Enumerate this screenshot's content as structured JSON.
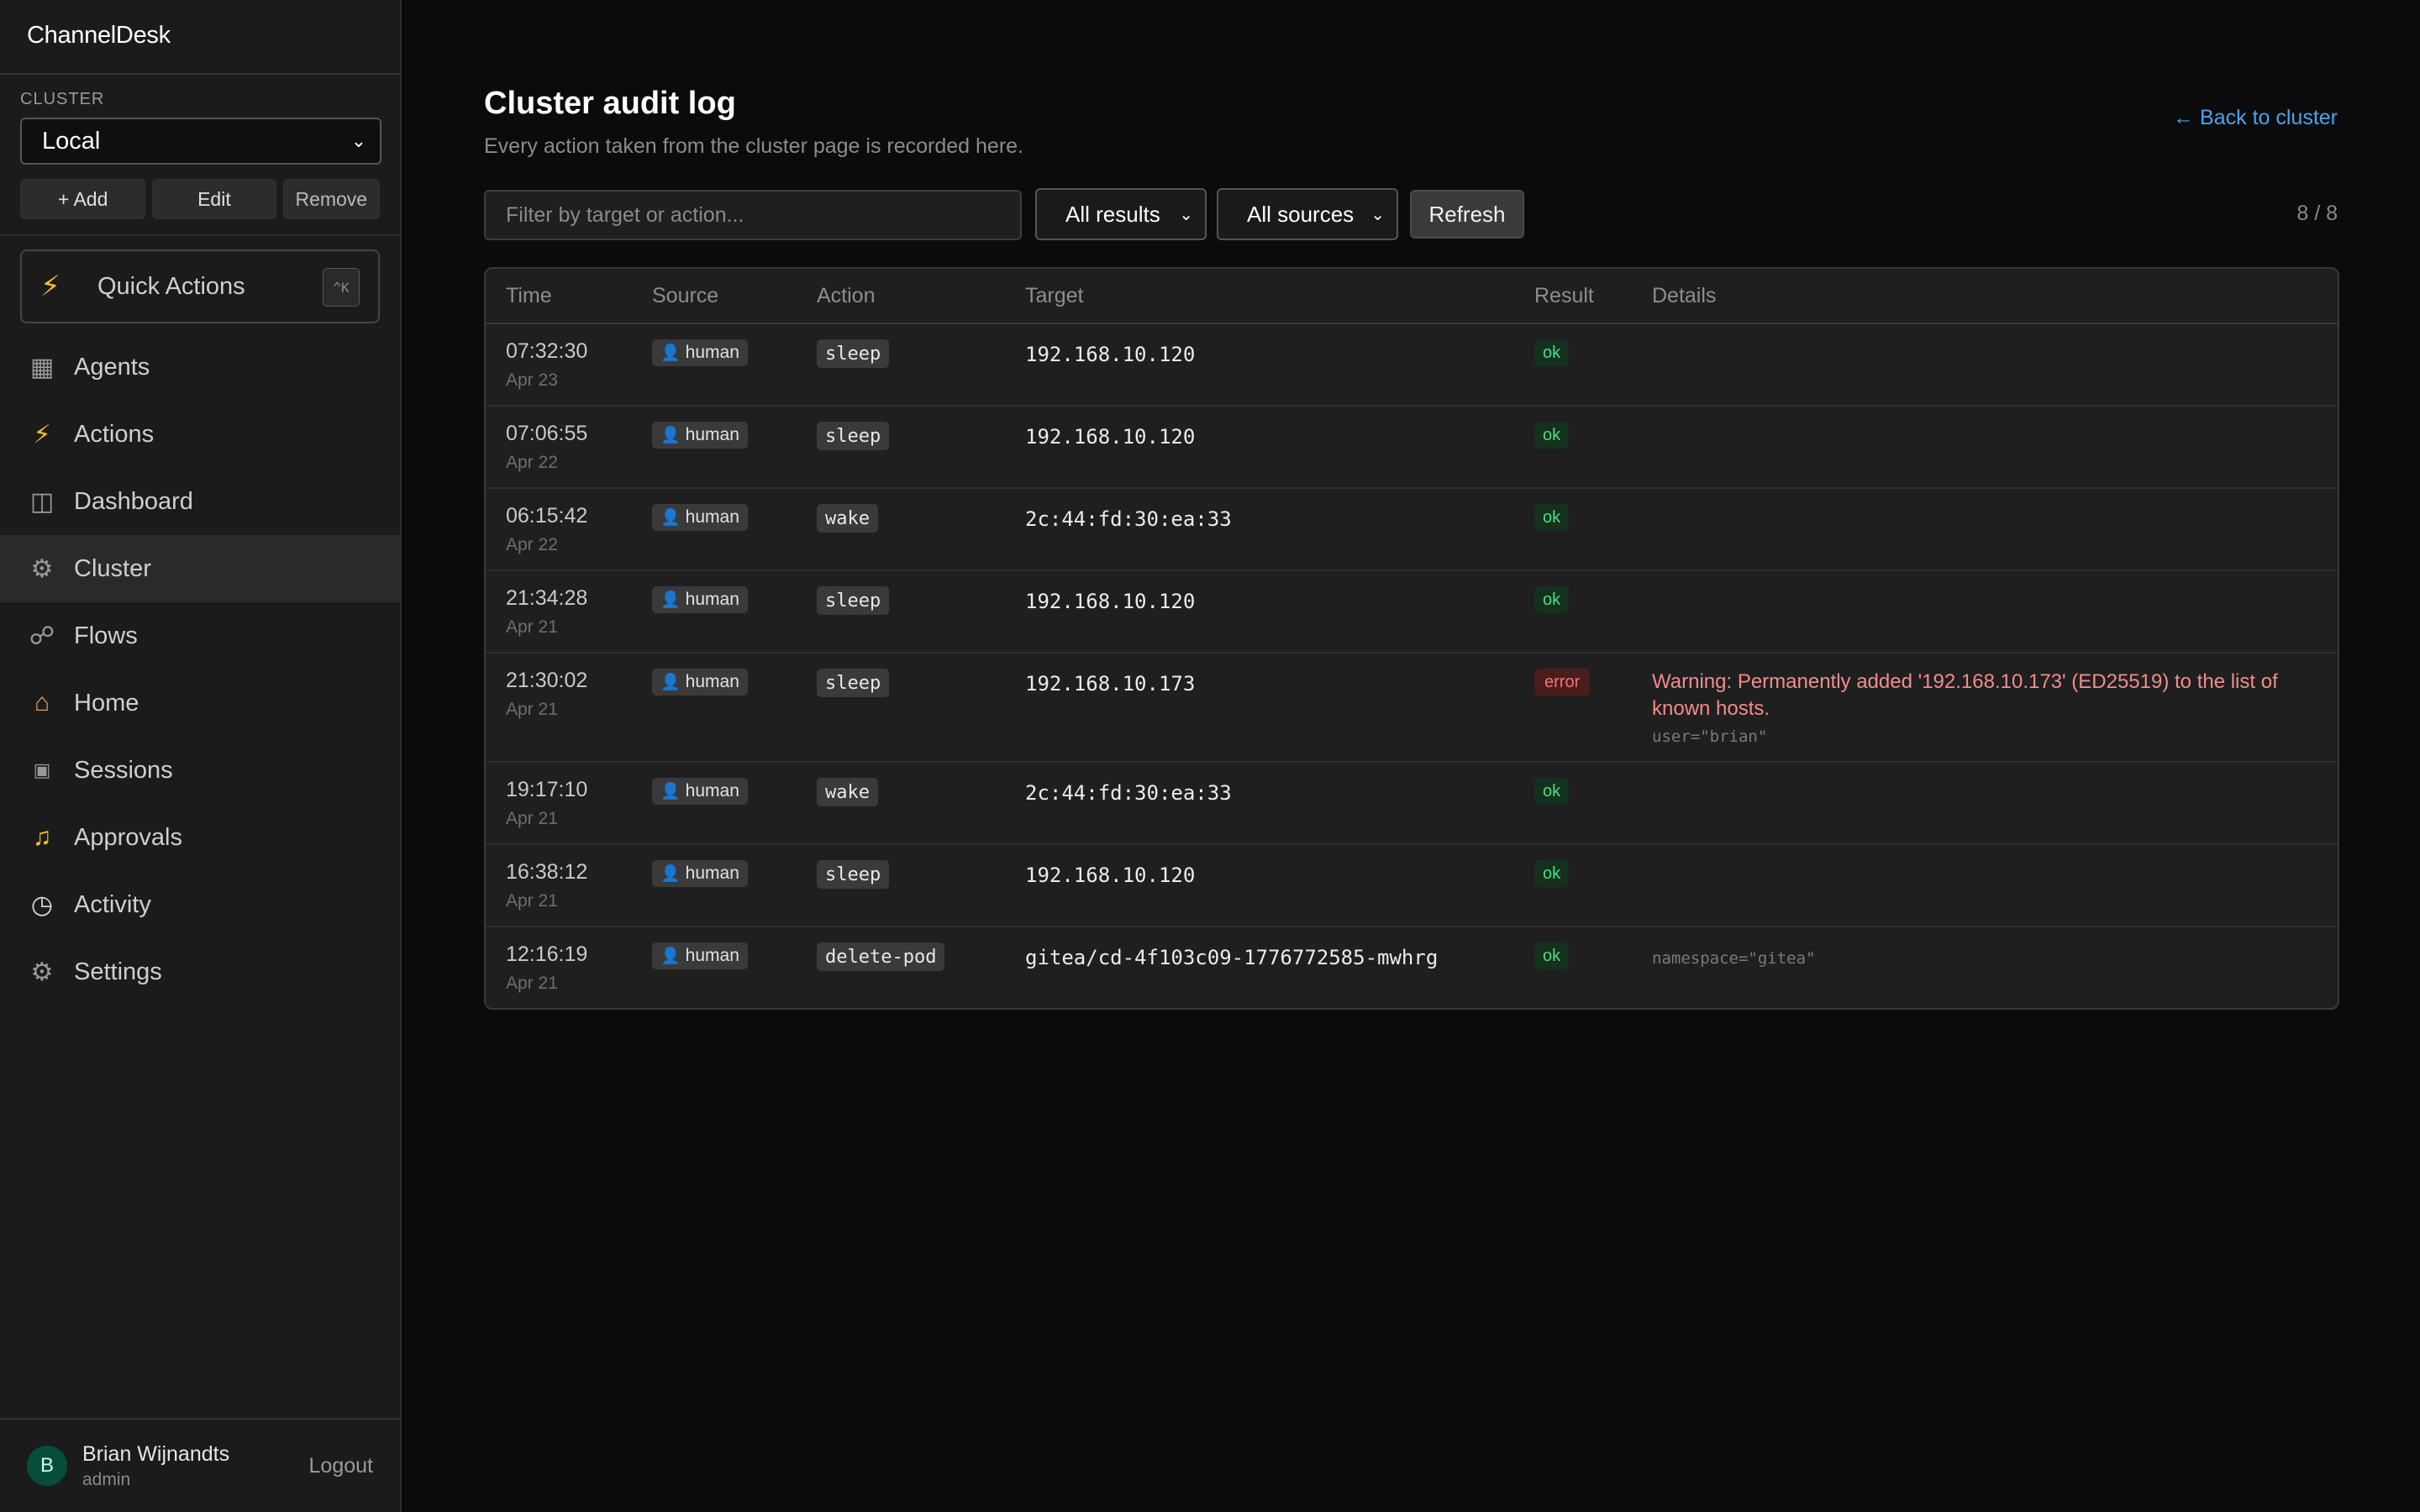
{
  "app": {
    "title": "ChannelDesk"
  },
  "sidebar": {
    "cluster_label": "CLUSTER",
    "cluster_value": "Local",
    "add_label": "+ Add",
    "edit_label": "Edit",
    "remove_label": "Remove",
    "quick_actions": {
      "label": "Quick Actions",
      "shortcut": "^K",
      "icon": "lightning-icon"
    },
    "items": [
      {
        "label": "Agents",
        "icon": "grid-icon"
      },
      {
        "label": "Actions",
        "icon": "lightning-icon"
      },
      {
        "label": "Dashboard",
        "icon": "panel-icon"
      },
      {
        "label": "Cluster",
        "icon": "gear-icon",
        "active": true
      },
      {
        "label": "Flows",
        "icon": "flow-icon"
      },
      {
        "label": "Home",
        "icon": "house-icon"
      },
      {
        "label": "Sessions",
        "icon": "card-icon"
      },
      {
        "label": "Approvals",
        "icon": "bell-icon"
      },
      {
        "label": "Activity",
        "icon": "clock-icon"
      },
      {
        "label": "Settings",
        "icon": "gear-icon"
      }
    ],
    "user": {
      "initial": "B",
      "name": "Brian Wijnandts",
      "role": "admin",
      "logout_label": "Logout"
    }
  },
  "main": {
    "title": "Cluster audit log",
    "subtitle": "Every action taken from the cluster page is recorded here.",
    "back_link": "← Back to cluster",
    "filter_placeholder": "Filter by target or action...",
    "results_filter": "All results",
    "sources_filter": "All sources",
    "refresh_label": "Refresh",
    "count": "8 / 8",
    "columns": {
      "time": "Time",
      "source": "Source",
      "action": "Action",
      "target": "Target",
      "result": "Result",
      "details": "Details"
    },
    "rows": [
      {
        "time": "07:32:30",
        "date": "Apr 23",
        "source": "human",
        "action": "sleep",
        "target": "192.168.10.120",
        "result": "ok",
        "details": "",
        "meta": ""
      },
      {
        "time": "07:06:55",
        "date": "Apr 22",
        "source": "human",
        "action": "sleep",
        "target": "192.168.10.120",
        "result": "ok",
        "details": "",
        "meta": ""
      },
      {
        "time": "06:15:42",
        "date": "Apr 22",
        "source": "human",
        "action": "wake",
        "target": "2c:44:fd:30:ea:33",
        "result": "ok",
        "details": "",
        "meta": ""
      },
      {
        "time": "21:34:28",
        "date": "Apr 21",
        "source": "human",
        "action": "sleep",
        "target": "192.168.10.120",
        "result": "ok",
        "details": "",
        "meta": ""
      },
      {
        "time": "21:30:02",
        "date": "Apr 21",
        "source": "human",
        "action": "sleep",
        "target": "192.168.10.173",
        "result": "error",
        "details": "Warning: Permanently added '192.168.10.173' (ED25519) to the list of known hosts.",
        "meta": "user=\"brian\""
      },
      {
        "time": "19:17:10",
        "date": "Apr 21",
        "source": "human",
        "action": "wake",
        "target": "2c:44:fd:30:ea:33",
        "result": "ok",
        "details": "",
        "meta": ""
      },
      {
        "time": "16:38:12",
        "date": "Apr 21",
        "source": "human",
        "action": "sleep",
        "target": "192.168.10.120",
        "result": "ok",
        "details": "",
        "meta": ""
      },
      {
        "time": "12:16:19",
        "date": "Apr 21",
        "source": "human",
        "action": "delete-pod",
        "target": "gitea/cd-4f103c09-1776772585-mwhrg",
        "result": "ok",
        "details": "",
        "meta": "namespace=\"gitea\""
      }
    ]
  },
  "colors": {
    "accent_link": "#4aa3f0",
    "ok": "#4ade80",
    "error": "#f87171",
    "warning_text": "#f48b8b",
    "avatar_bg": "#064e3b"
  }
}
